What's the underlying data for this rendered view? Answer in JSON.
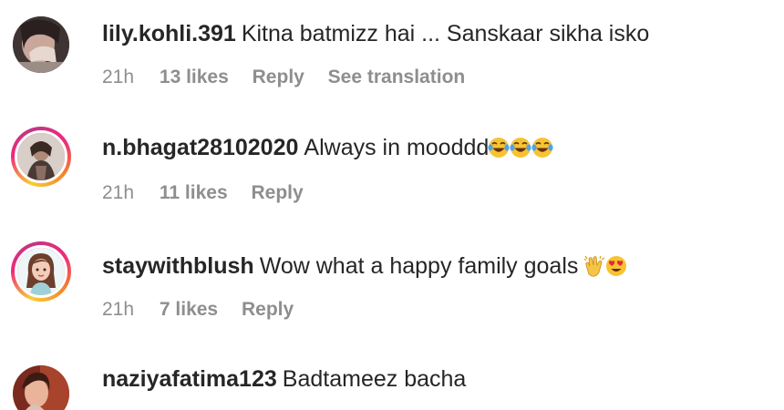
{
  "comments": [
    {
      "username": "lily.kohli.391",
      "text": "Kitna batmizz hai ... Sanskaar sikha isko",
      "time": "21h",
      "likes": "13 likes",
      "reply": "Reply",
      "translate": "See translation",
      "avatar_ring": false
    },
    {
      "username": "n.bhagat28102020",
      "text": "Always in mooddd",
      "emojis": [
        "face-with-tears-of-joy",
        "face-with-tears-of-joy",
        "face-with-tears-of-joy"
      ],
      "time": "21h",
      "likes": "11 likes",
      "reply": "Reply",
      "avatar_ring": true
    },
    {
      "username": "staywithblush",
      "text": "Wow what a happy family goals",
      "emojis": [
        "clapping-hands",
        "heart-eyes-face"
      ],
      "time": "21h",
      "likes": "7 likes",
      "reply": "Reply",
      "avatar_ring": true
    },
    {
      "username": "naziyafatima123",
      "text": "Badtameez bacha",
      "avatar_ring": false
    }
  ],
  "colors": {
    "text": "#262626",
    "meta": "#8e8e8e",
    "story_ring": [
      "#f9ce34",
      "#ee2a7b",
      "#6228d7"
    ]
  }
}
